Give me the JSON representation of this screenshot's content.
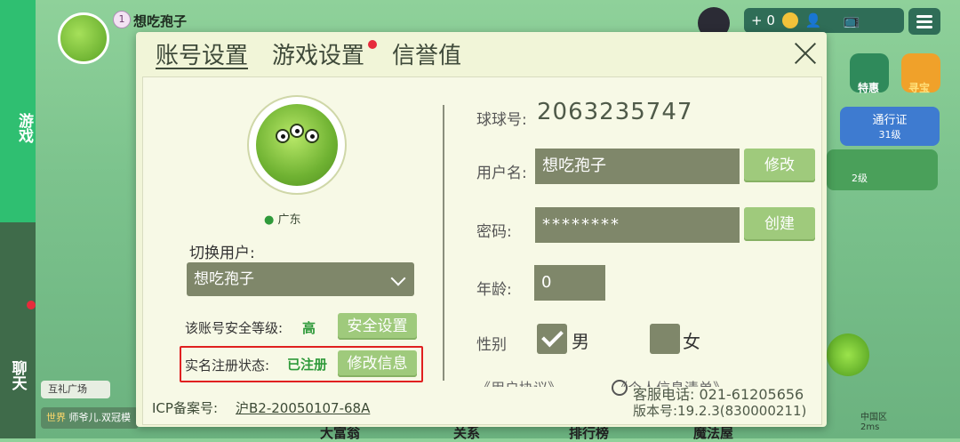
{
  "left_tabs": {
    "game": "游戏",
    "chat": "聊天"
  },
  "player": {
    "name": "想吃孢子",
    "level": "1"
  },
  "top_bar": {
    "coins": "+ 0"
  },
  "right_side": {
    "special": "特惠",
    "treasure": "寻宝",
    "pass": "通行证",
    "pass_level": "31级",
    "tile_level": "2级"
  },
  "chat": {
    "gift_plaza": "互礼广场",
    "world_tag": "世界",
    "world_msg": "师爷儿.双冠模"
  },
  "status": {
    "region": "中国区",
    "ping": "2ms"
  },
  "bottom_nav": [
    "大富翁",
    "关系",
    "排行榜",
    "魔法屋"
  ],
  "dialog": {
    "tabs": {
      "account": "账号设置",
      "game": "游戏设置",
      "credit": "信誉值"
    },
    "location": "广东",
    "switch_user_label": "切换用户:",
    "selected_user": "想吃孢子",
    "security_label": "该账号安全等级:",
    "security_level": "高",
    "security_button": "安全设置",
    "realname_label": "实名注册状态:",
    "realname_value": "已注册",
    "edit_info_button": "修改信息",
    "icp_label": "ICP备案号:",
    "icp_value": "沪B2-20050107-68A",
    "qq_label": "球球号:",
    "qq_value": "2063235747",
    "username_label": "用户名:",
    "username_value": "想吃孢子",
    "username_button": "修改",
    "password_label": "密码:",
    "password_value": "********",
    "password_button": "创建",
    "age_label": "年龄:",
    "age_value": "0",
    "gender_label": "性别",
    "male": "男",
    "female": "女",
    "agreement": "《用户协议》",
    "privacy": "《个人信息清单》",
    "service_phone": "客服电话: 021-61205656",
    "version": "版本号:19.2.3(830000211)"
  }
}
